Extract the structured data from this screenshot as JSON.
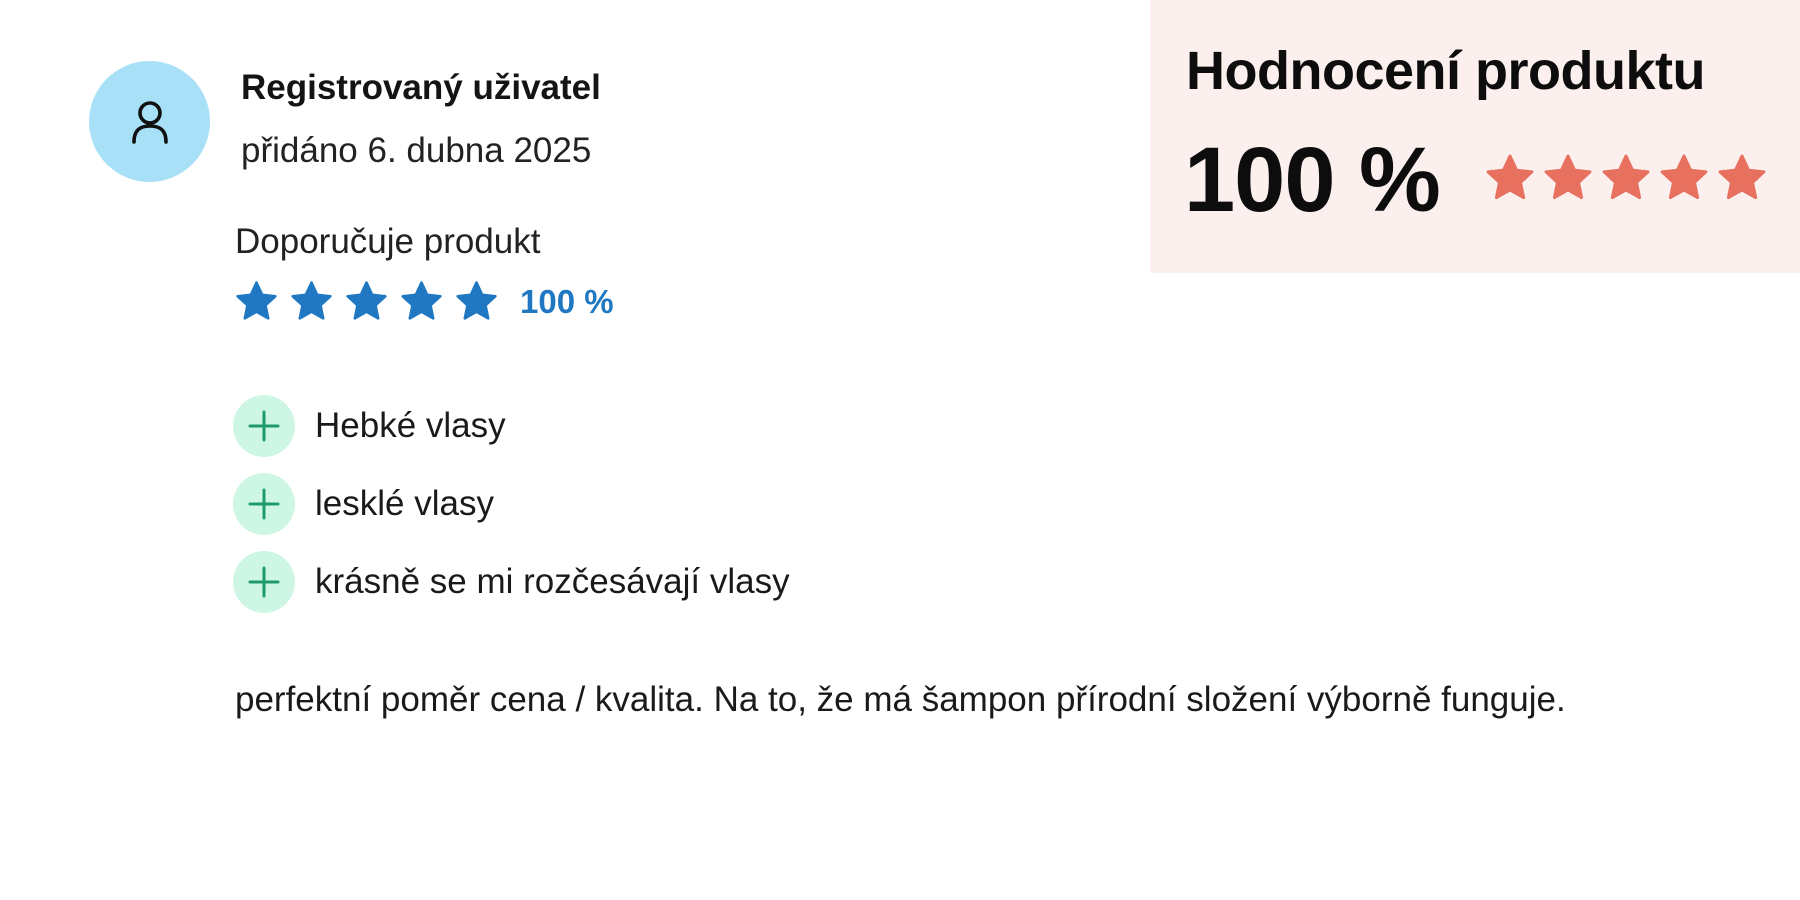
{
  "summary": {
    "title": "Hodnocení produktu",
    "score": "100 %",
    "stars": 5,
    "stars_max": 5,
    "star_color": "#e8705f",
    "background": "#fbf0ed",
    "star_icon": "star-icon"
  },
  "review": {
    "avatar_icon": "user-icon",
    "avatar_color": "#a8e0f8",
    "author": "Registrovaný uživatel",
    "date": "přidáno 6. dubna 2025",
    "recommend_label": "Doporučuje produkt",
    "rating": {
      "stars": 5,
      "stars_max": 5,
      "percent_label": "100 %",
      "color": "#1f78c1"
    },
    "pros_icon": "plus-icon",
    "pros_icon_bg": "#cdf6e4",
    "pros_icon_color": "#1e9b6b",
    "pros": [
      "Hebké vlasy",
      "lesklé vlasy",
      "krásně se mi rozčesávají vlasy"
    ],
    "comment": "perfektní poměr cena / kvalita. Na to, že má šampon přírodní složení výborně funguje."
  }
}
